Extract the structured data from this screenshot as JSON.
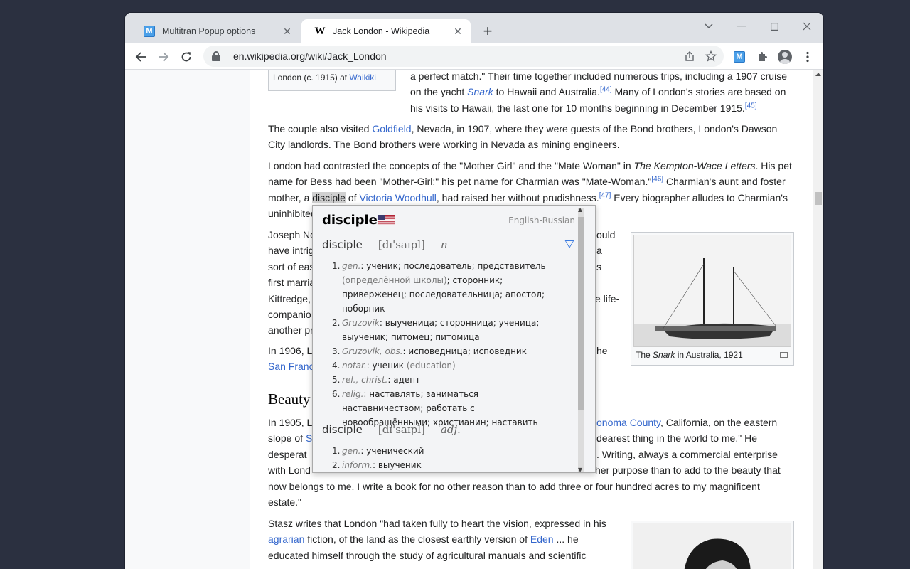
{
  "tabs": [
    {
      "title": "Multitran Popup options",
      "favicon": "M"
    },
    {
      "title": "Jack London - Wikipedia",
      "favicon": "W"
    }
  ],
  "url": "en.wikipedia.org/wiki/Jack_London",
  "article": {
    "thumb1_caption_line1": "London (c. 1915) at ",
    "thumb1_caption_link": "Waikiki",
    "p_top": [
      {
        "text": "a perfect match.\" Their time together included numerous trips, including a 1907 cruise"
      },
      {
        "pre": "on the yacht ",
        "italic_link": "Snark",
        "post": " to Hawaii and Australia.",
        "sup": "[44]",
        "post2": " Many of London's stories are based on"
      },
      {
        "pre": "his visits to Hawaii, the last one for 10 months beginning in December 1915.",
        "sup": "[45]"
      }
    ],
    "p_couple": {
      "pre": "The couple also visited ",
      "link": "Goldfield",
      "post": ", Nevada, in 1907, where they were guests of the Bond brothers, London's Dawson",
      "line2": "City landlords. The Bond brothers were working in Nevada as mining engineers."
    },
    "p_contrast": {
      "l1_pre": "London had contrasted the concepts of the \"Mother Girl\" and the \"Mate Woman\" in ",
      "l1_italic": "The Kempton-Wace Letters",
      "l1_post": ". His pet",
      "l2": "name for Bess had been \"Mother-Girl;\" his pet name for Charmian was \"Mate-Woman.\"",
      "l2_sup": "[46]",
      "l2_post": " Charmian's aunt and foster",
      "l3_pre": "mother, a ",
      "l3_highlight": "disciple",
      "l3_mid": " of ",
      "l3_link": "Victoria Woodhull",
      "l3_post": ", had raised her without prudishness.",
      "l3_sup": "[47]",
      "l3_post2": " Every biographer alludes to Charmian's",
      "l4": "uninhibited"
    },
    "p_joseph": [
      "Joseph No",
      "have intrig",
      "sort of eas",
      "first marria",
      "Kittredge,",
      "companio",
      "another pr"
    ],
    "p_joseph_right": [
      "ould",
      "a",
      "s",
      "",
      "e life-",
      "",
      ""
    ],
    "p_1906": {
      "l1": "In 1906, L",
      "l1_right": "he",
      "l2_link": "San Franc"
    },
    "heading": "Beauty",
    "p_1905": {
      "l1": "In 1905, L",
      "l1_link": "onoma County",
      "l1_post": ", California, on the eastern",
      "l2_pre": "slope of ",
      "l2_link": "S",
      "l2_right": " dearest thing in the world to me.\" He",
      "l3": "desperat",
      "l3_right": ". Writing, always a commercial enterprise",
      "l4": "with Lond",
      "l4_right": "her purpose than to add to the beauty that",
      "l5": "now belongs to me. I write a book for no other reason than to add three or four hundred acres to my magnificent",
      "l6": "estate.\""
    },
    "p_stasz": {
      "l1": "Stasz writes that London \"had taken fully to heart the vision, expressed in his",
      "l2_link": "agrarian",
      "l2_mid": " fiction, of the land as the closest earthly version of ",
      "l2_link2": "Eden",
      "l2_post": " ... he",
      "l3": "educated himself through the study of agricultural manuals and scientific"
    },
    "snark_caption_pre": "The ",
    "snark_caption_italic": "Snark",
    "snark_caption_post": " in Australia, 1921"
  },
  "popup": {
    "headword": "disciple",
    "dictionary": "English-Russian",
    "entries": [
      {
        "word": "disciple",
        "transcription": "[dɪ'saɪpl]",
        "pos": "n",
        "senses": [
          {
            "num": "1.",
            "subject": "gen.",
            "text": " ученик; последователь; представитель ",
            "comment": "(определённой школы)",
            "text2": "; сторонник; приверженец; последовательница; апостол; поборник"
          },
          {
            "num": "2.",
            "subject": "Gruzovik",
            "text": " выученица; сторонница; ученица; выученик; питомец; питомица"
          },
          {
            "num": "3.",
            "subject": "Gruzovik, obs.",
            "text": " исповедница; исповедник"
          },
          {
            "num": "4.",
            "subject": "notar.",
            "text": " ученик ",
            "comment": "(education)"
          },
          {
            "num": "5.",
            "subject": "rel., christ.",
            "text": " адепт"
          },
          {
            "num": "6.",
            "subject": "relig.",
            "text": " наставлять; заниматься наставничеством; работать с новообращёнными; христианин; наставить"
          }
        ]
      },
      {
        "word": "disciple",
        "transcription": "[dɪ'saɪpl]",
        "pos": "adj.",
        "senses": [
          {
            "num": "1.",
            "subject": "gen.",
            "text": " ученический"
          },
          {
            "num": "2.",
            "subject": "inform.",
            "text": " выученик"
          }
        ]
      }
    ]
  }
}
